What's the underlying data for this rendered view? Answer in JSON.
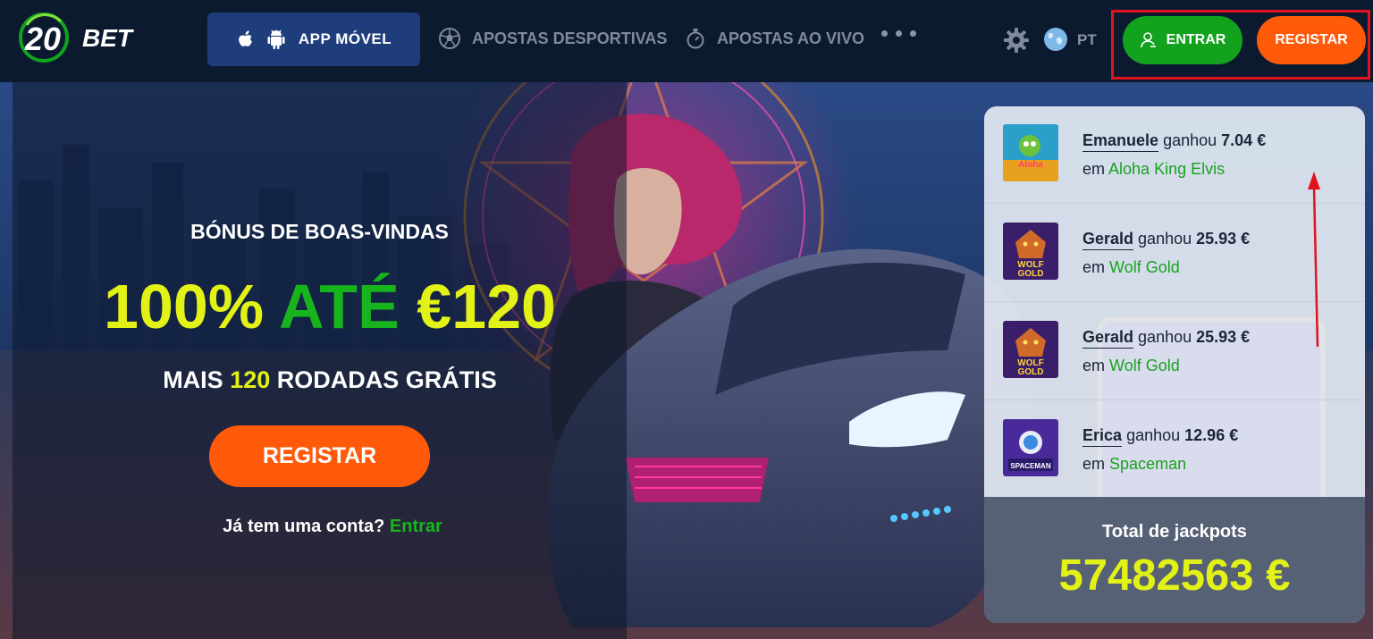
{
  "header": {
    "logo_number": "20",
    "logo_text": "BET",
    "app_button_label": "APP MÓVEL",
    "nav": [
      {
        "label": "APOSTAS DESPORTIVAS",
        "icon": "soccer-ball-icon"
      },
      {
        "label": "APOSTAS AO VIVO",
        "icon": "stopwatch-icon"
      }
    ],
    "language": "PT",
    "login_label": "ENTRAR",
    "register_label": "REGISTAR"
  },
  "promo": {
    "subtitle": "BÓNUS DE BOAS-VINDAS",
    "headline_part1": "100%",
    "headline_part2": "ATÉ",
    "headline_part3": "€120",
    "extra_prefix": "MAIS",
    "extra_number": "120",
    "extra_suffix": "RODADAS GRÁTIS",
    "register_label": "REGISTAR",
    "login_question": "Já tem uma conta?",
    "login_link": "Entrar"
  },
  "winners": [
    {
      "name": "Emanuele",
      "verb": "ganhou",
      "amount": "7.04 €",
      "prefix": "em",
      "game": "Aloha King Elvis"
    },
    {
      "name": "Gerald",
      "verb": "ganhou",
      "amount": "25.93 €",
      "prefix": "em",
      "game": "Wolf Gold"
    },
    {
      "name": "Gerald",
      "verb": "ganhou",
      "amount": "25.93 €",
      "prefix": "em",
      "game": "Wolf Gold"
    },
    {
      "name": "Erica",
      "verb": "ganhou",
      "amount": "12.96 €",
      "prefix": "em",
      "game": "Spaceman"
    }
  ],
  "thumb_text": {
    "aloha": "Aloha",
    "wolf_top": "WOLF",
    "wolf_bottom": "GOLD",
    "spaceman": "SPACEMAN"
  },
  "jackpot": {
    "label": "Total de jackpots",
    "value": "57482563 €"
  },
  "colors": {
    "header_bg": "#0c1a30",
    "app_button_bg": "#1e3d7a",
    "green": "#12a21e",
    "orange": "#ff5a0a",
    "yellow": "#e3f216",
    "highlight_red": "#e0141e"
  }
}
